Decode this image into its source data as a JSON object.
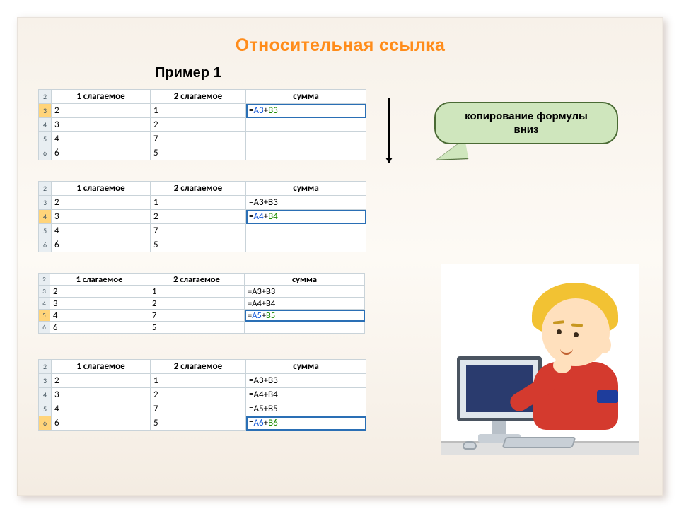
{
  "title": "Относительная ссылка",
  "subtitle": "Пример 1",
  "callout": {
    "line1": "копирование формулы",
    "line2": "вниз"
  },
  "headers": {
    "a": "1 слагаемое",
    "b": "2 слагаемое",
    "c": "сумма"
  },
  "base_data": {
    "row_labels": [
      "2",
      "3",
      "4",
      "5",
      "6"
    ],
    "r3": {
      "a": "2",
      "b": "1"
    },
    "r4": {
      "a": "3",
      "b": "2"
    },
    "r5": {
      "a": "4",
      "b": "7"
    },
    "r6": {
      "a": "6",
      "b": "5"
    }
  },
  "formulas": {
    "c3": {
      "eq": "=",
      "ref1": "A3",
      "plus": "+",
      "ref2": "B3",
      "plain": "=A3+B3"
    },
    "c4": {
      "eq": "=",
      "ref1": "A4",
      "plus": "+",
      "ref2": "B4",
      "plain": "=A4+B4"
    },
    "c5": {
      "eq": "=",
      "ref1": "A5",
      "plus": "+",
      "ref2": "B5",
      "plain": "=A5+B5"
    },
    "c6": {
      "eq": "=",
      "ref1": "A6",
      "plus": "+",
      "ref2": "B6",
      "plain": "=A6+B6"
    }
  }
}
